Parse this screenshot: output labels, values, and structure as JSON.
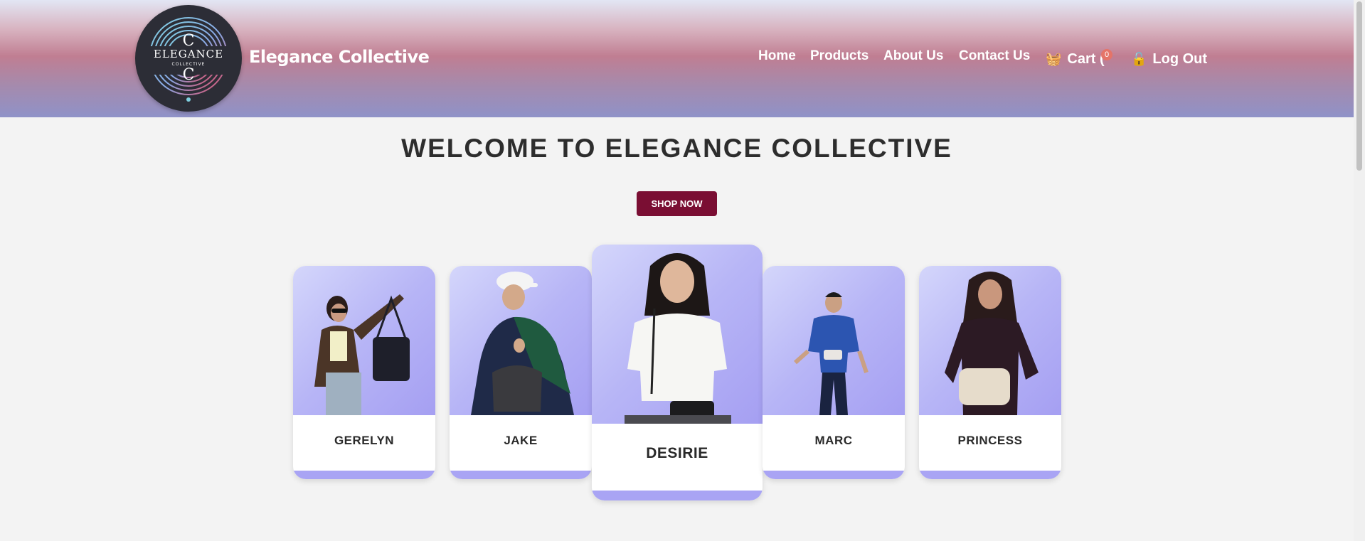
{
  "header": {
    "logo": {
      "top_letter": "C",
      "word": "ELEGANCE",
      "sub": "COLLECTIVE",
      "bottom_letter": "C"
    },
    "brand_name": "Elegance Collective",
    "nav": {
      "home": "Home",
      "products": "Products",
      "about": "About Us",
      "contact": "Contact Us",
      "cart_label": "Cart (",
      "cart_count": "0",
      "logout": "Log Out"
    },
    "icons": {
      "cart": "shopping-basket-icon",
      "logout": "unlocked-padlock-icon"
    }
  },
  "main": {
    "title": "WELCOME TO ELEGANCE COLLECTIVE",
    "shop_button": "SHOP NOW",
    "models": [
      {
        "name": "GERELYN"
      },
      {
        "name": "JAKE"
      },
      {
        "name": "DESIRIE"
      },
      {
        "name": "MARC"
      },
      {
        "name": "PRINCESS"
      }
    ]
  },
  "colors": {
    "accent_button": "#7a0e33",
    "card_bar": "#a9a4f4",
    "badge": "#e57468",
    "heading": "#2d2d2d"
  }
}
